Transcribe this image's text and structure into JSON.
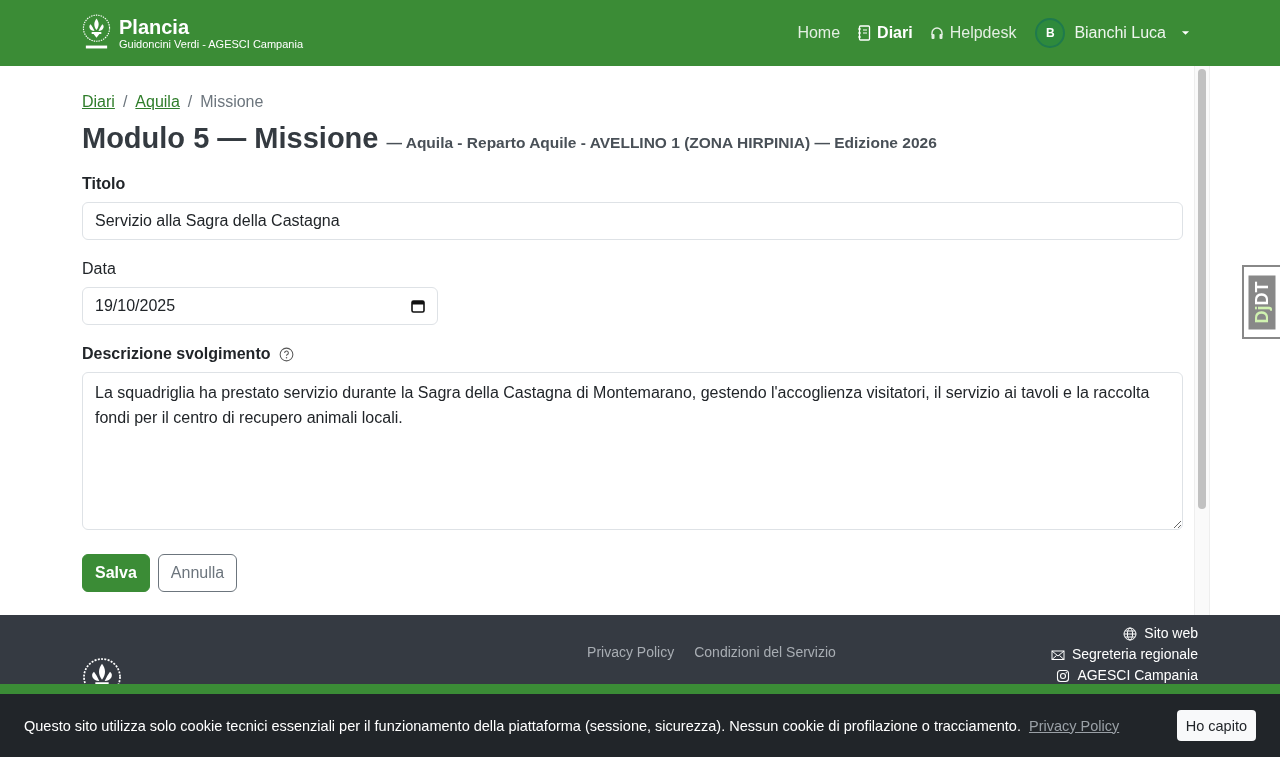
{
  "navbar": {
    "brand": {
      "title": "Plancia",
      "subtitle": "Guidoncini Verdi - AGESCI Campania"
    },
    "links": [
      {
        "label": "Home",
        "selected": false
      },
      {
        "label": "Diari",
        "selected": true
      },
      {
        "label": "Helpdesk",
        "selected": false
      }
    ],
    "user": {
      "initial": "B",
      "name": "Bianchi Luca"
    }
  },
  "breadcrumb": [
    {
      "label": "Diari",
      "kind": "link"
    },
    {
      "label": "/",
      "kind": "separator"
    },
    {
      "label": "Aquila",
      "kind": "link"
    },
    {
      "label": "/",
      "kind": "separator"
    },
    {
      "label": "Missione",
      "kind": "current"
    }
  ],
  "heading": {
    "title": "Modulo 5 — Missione",
    "subtitle": "— Aquila - Reparto Aquile - AVELLINO 1 (ZONA HIRPINIA) — Edizione 2026"
  },
  "fields": [
    {
      "kind": "text",
      "label": "Titolo",
      "value": "Servizio alla Sagra della Castagna",
      "bold_label": true
    },
    {
      "kind": "date",
      "label": "Data",
      "value": "19/10/2025",
      "bold_label": false
    },
    {
      "kind": "textarea",
      "label": "Descrizione svolgimento",
      "value": "La squadriglia ha prestato servizio durante la Sagra della Castagna di Montemarano, gestendo l'accoglienza visitatori, il servizio ai tavoli e la raccolta fondi per il centro di recupero animali locali.",
      "bold_label": true,
      "help": true
    }
  ],
  "buttons": [
    {
      "label": "Salva",
      "kind": "primary"
    },
    {
      "label": "Annulla",
      "kind": "secondary"
    }
  ],
  "footer": {
    "links": [
      "Privacy Policy",
      "Condizioni del Servizio"
    ],
    "contacts": [
      "Sito web",
      "Segreteria regionale",
      "AGESCI Campania"
    ]
  },
  "cookie_banner": {
    "text": "Questo sito utilizza solo cookie tecnici essenziali per il funzionamento della piattaforma (sessione, sicurezza). Nessun cookie di profilazione o tracciamento.",
    "link": "Privacy Policy",
    "button": "Ho capito"
  },
  "debug_toolbar": {
    "prefix": "Dj",
    "rest": "DT"
  }
}
